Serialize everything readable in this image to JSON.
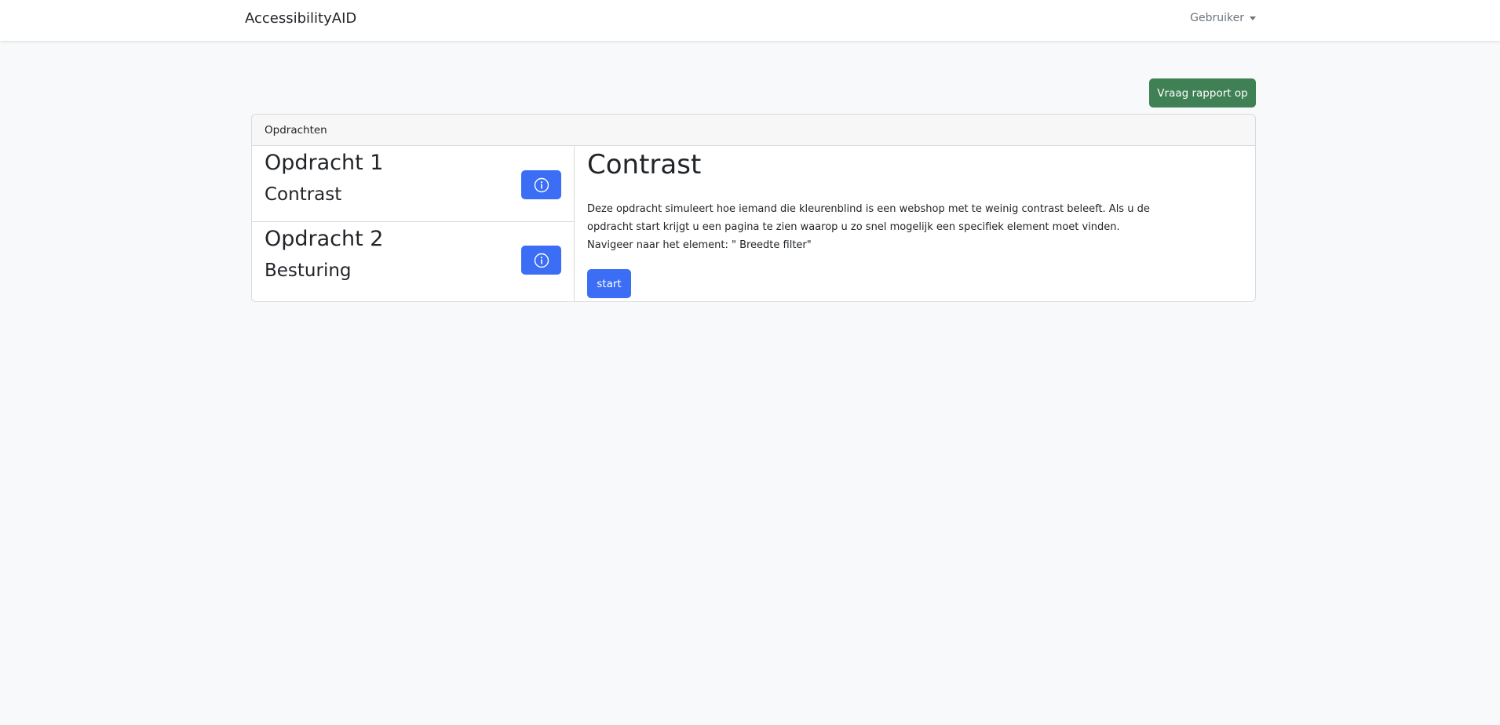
{
  "navbar": {
    "brand": "AccessibilityAID",
    "user_menu_label": "Gebruiker",
    "user_menu_icon": "caret-down-icon"
  },
  "toolbar": {
    "report_button_label": "Vraag rapport op",
    "report_button_color": "#3f8054"
  },
  "card": {
    "header": "Opdrachten",
    "tasks": [
      {
        "title": "Opdracht 1",
        "subtitle": "Contrast",
        "icon": "info-icon"
      },
      {
        "title": "Opdracht 2",
        "subtitle": "Besturing",
        "icon": "info-icon"
      }
    ],
    "detail": {
      "title": "Contrast",
      "description": "Deze opdracht simuleert hoe iemand die kleurenblind is een webshop met te weinig contrast beleeft. Als u de opdracht start krijgt u een pagina te zien waarop u zo snel mogelijk een specifiek element moet vinden.",
      "navigation": "Navigeer naar het element: \" Breedte filter\"",
      "start_label": "start"
    },
    "primary_color": "#3b6ef5"
  }
}
